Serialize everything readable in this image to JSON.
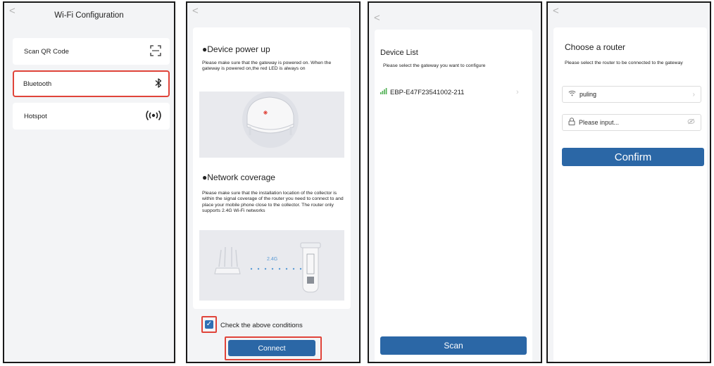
{
  "screen1": {
    "back": "<",
    "title": "Wi-Fi Configuration",
    "items": [
      {
        "label": "Scan QR Code",
        "icon": "qr-scan-icon",
        "glyph": "⛶"
      },
      {
        "label": "Bluetooth",
        "icon": "bluetooth-icon",
        "glyph": "ᛒ"
      },
      {
        "label": "Hotspot",
        "icon": "hotspot-icon",
        "glyph": "((•))"
      }
    ]
  },
  "screen2": {
    "back": "<",
    "section1_title": "●Device power up",
    "section1_text": "Please make sure that the gateway is powered on. When the gateway is powered on,the red LED is always on",
    "section2_title": "●Network coverage",
    "section2_text": "Please make sure that the installation location of the collector is within the signal coverage of the router you need to connect to and place your mobile phone close to the collector. The router only supports 2.4G Wi-Fi networks",
    "band_label": "2.4G",
    "check_label": "Check the above conditions",
    "check_mark": "✓",
    "connect_label": "Connect"
  },
  "screen3": {
    "back": "<",
    "title": "Device List",
    "subtitle": "Please select the gateway you want to configure",
    "device_name": "EBP-E47F23541002-211",
    "scan_label": "Scan"
  },
  "screen4": {
    "back": "<",
    "title": "Choose a router",
    "subtitle": "Please select the router to be connected to the gateway",
    "ssid": "puling",
    "password_placeholder": "Please input...",
    "confirm_label": "Confirm"
  },
  "colors": {
    "highlight": "#e0443a",
    "primary_button": "#2b67a6",
    "led": "#e0443a",
    "wifi_band": "#5b9bd5",
    "signal": "#4caf50"
  }
}
